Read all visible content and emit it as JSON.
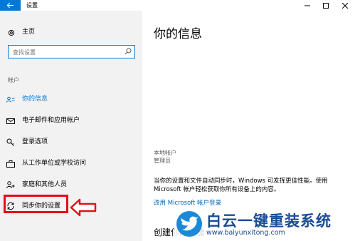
{
  "window": {
    "title": "设置"
  },
  "sidebar": {
    "home_label": "主页",
    "search_placeholder": "查找设置",
    "section_title": "帐户",
    "items": [
      {
        "label": "你的信息",
        "icon": "person-card-icon",
        "active": true
      },
      {
        "label": "电子邮件和应用帐户",
        "icon": "mail-icon",
        "active": false
      },
      {
        "label": "登录选项",
        "icon": "key-icon",
        "active": false
      },
      {
        "label": "从工作单位或学校访问",
        "icon": "briefcase-icon",
        "active": false
      },
      {
        "label": "家庭和其他人员",
        "icon": "person-plus-icon",
        "active": false
      },
      {
        "label": "同步你的设置",
        "icon": "sync-icon",
        "active": false
      }
    ]
  },
  "main": {
    "title": "你的信息",
    "account_type": "本地帐户",
    "account_role": "管理员",
    "description": "当你的设置和文件自动同步时，Windows 可发挥更佳性能。使用 Microsoft 帐户轻松获取你所有设备上的内容。",
    "link": "改用 Microsoft 帐户登录",
    "create_heading": "创建你的头像"
  },
  "watermark": {
    "text_cn": "白云一键重装系统",
    "text_en": "www.baiyunxitong.com"
  },
  "colors": {
    "accent": "#0078d7",
    "highlight_red": "#e1101b",
    "watermark_blue": "#1a4c96"
  }
}
